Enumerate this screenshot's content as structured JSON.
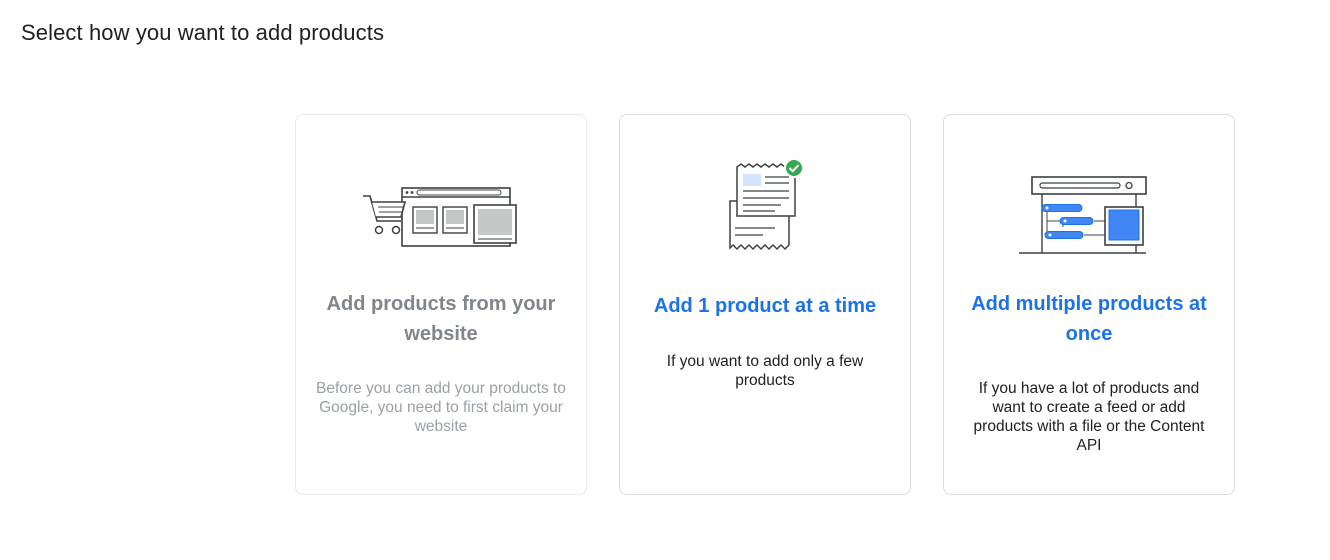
{
  "page": {
    "title": "Select how you want to add products"
  },
  "cards": [
    {
      "title": "Add products from your website",
      "description": "Before you can add your products to Google, you need to first claim your website",
      "icon": "shopping-website-illustration",
      "state": "disabled"
    },
    {
      "title": "Add 1 product at a time",
      "description": "If you want to add only a few products",
      "icon": "single-product-document-illustration"
    },
    {
      "title": "Add multiple products at once",
      "description": "If you have a lot of products and want to create a feed or add products with a file or the Content API",
      "icon": "product-feed-illustration"
    }
  ],
  "colors": {
    "accent": "#1a73e8",
    "disabled_text": "#80868b",
    "success": "#34a853",
    "border": "#dadce0"
  }
}
